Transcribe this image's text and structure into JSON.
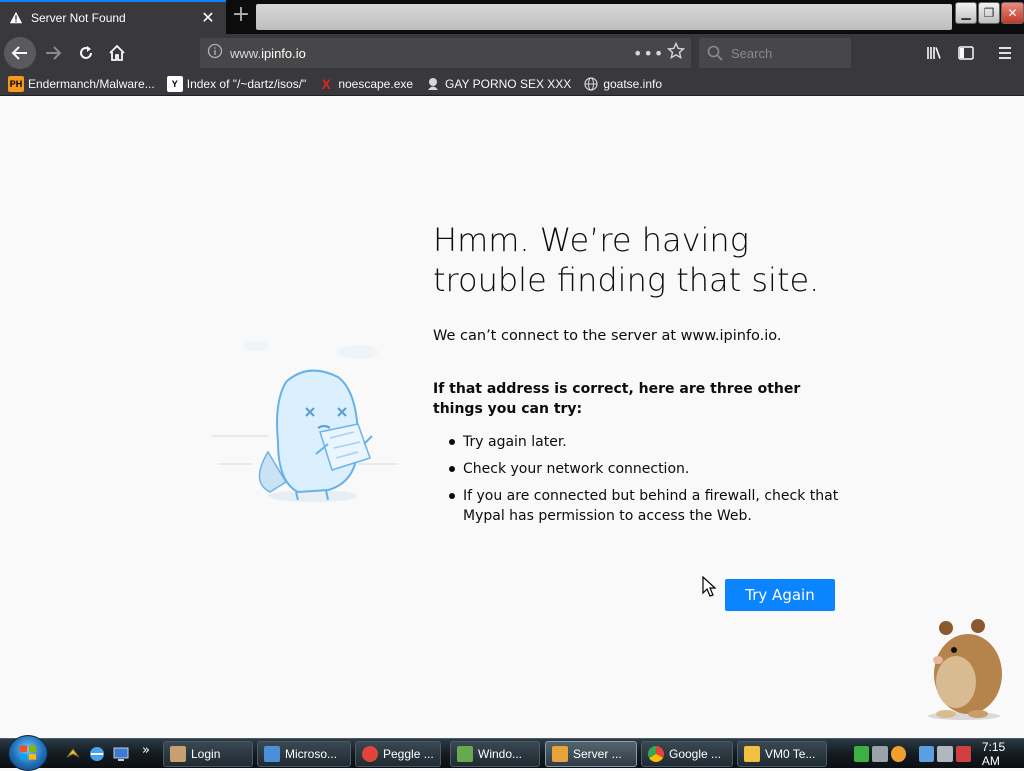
{
  "tab": {
    "title": "Server Not Found",
    "close": "✕",
    "new_tab": "+"
  },
  "window_buttons": {
    "minimize": "▁",
    "restore": "❐",
    "close": "✕"
  },
  "urlbar": {
    "url_prefix": "www.",
    "url_host": "ipinfo.io",
    "page_actions": "•••"
  },
  "search": {
    "placeholder": "Search"
  },
  "bookmarks": [
    {
      "label": "Endermanch/Malware...",
      "icon": "PH",
      "color": "#f7971d"
    },
    {
      "label": "Index of \"/~dartz/isos/\"",
      "icon": "Y",
      "color": "#2b2b2b"
    },
    {
      "label": "noescape.exe",
      "icon": "X",
      "color": "#d0021b"
    },
    {
      "label": "GAY PORNO SEX XXX",
      "icon": "boy-icon",
      "color": "#cccccc"
    },
    {
      "label": "goatse.info",
      "icon": "globe-icon",
      "color": "#cccccc"
    }
  ],
  "error": {
    "title": "Hmm. We’re having trouble finding that site.",
    "description": "We can’t connect to the server at www.ipinfo.io.",
    "suggestions_heading": "If that address is correct, here are three other things you can try:",
    "suggestions": [
      "Try again later.",
      "Check your network connection.",
      "If you are connected but behind a firewall, check that Mypal has permission to access the Web."
    ],
    "button": "Try Again"
  },
  "taskbar": {
    "tasks": [
      {
        "label": "Login",
        "color": "#c8a070"
      },
      {
        "label": "Microso...",
        "color": "#4a90d9"
      },
      {
        "label": "Peggle ...",
        "color": "#e0453a"
      },
      {
        "label": "Windo...",
        "color": "#6aa84f"
      },
      {
        "label": "Server ...",
        "color": "#e8a23a",
        "active": true
      },
      {
        "label": "Google ...",
        "color": "#4285f4"
      },
      {
        "label": "VM0 Te...",
        "color": "#f0c040"
      }
    ],
    "more": "»",
    "clock": "7:15 AM"
  },
  "colors": {
    "accent": "#0a84ff",
    "toolbar": "#38383d",
    "tab_strip": "#0c0c0d"
  }
}
